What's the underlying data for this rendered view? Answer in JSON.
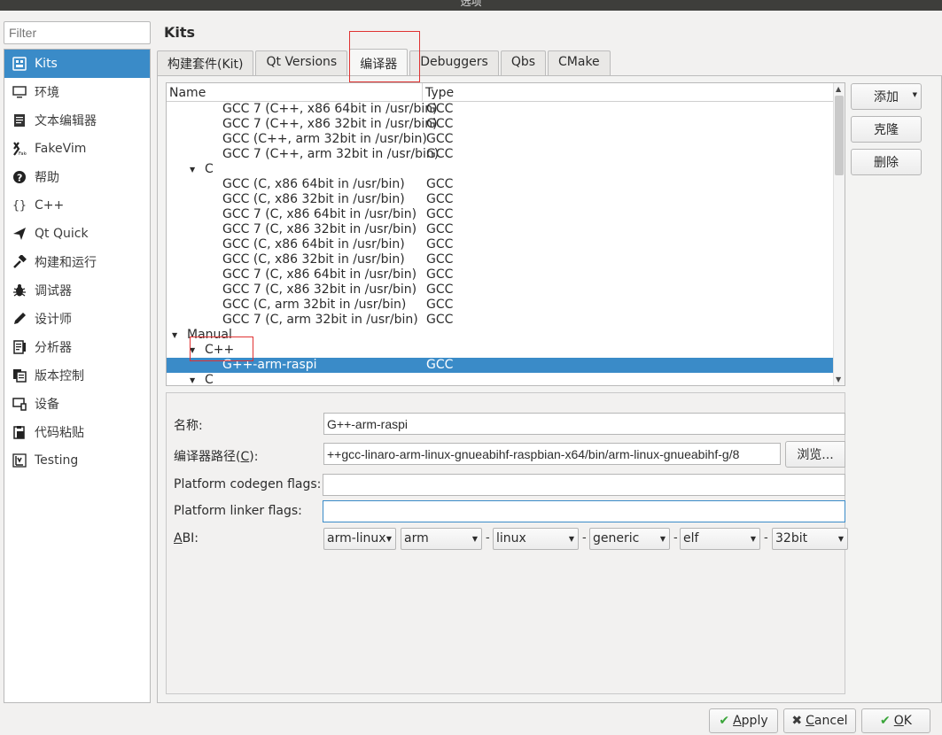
{
  "window": {
    "title": "选项"
  },
  "filter": {
    "placeholder": "Filter"
  },
  "sidebar": {
    "items": [
      {
        "label": "Kits",
        "icon": "kits-icon",
        "active": true
      },
      {
        "label": "环境",
        "icon": "monitor-icon"
      },
      {
        "label": "文本编辑器",
        "icon": "text-editor-icon"
      },
      {
        "label": "FakeVim",
        "icon": "fakevim-icon"
      },
      {
        "label": "帮助",
        "icon": "help-icon"
      },
      {
        "label": "C++",
        "icon": "braces-icon"
      },
      {
        "label": "Qt Quick",
        "icon": "qt-quick-icon"
      },
      {
        "label": "构建和运行",
        "icon": "hammer-icon"
      },
      {
        "label": "调试器",
        "icon": "bug-icon"
      },
      {
        "label": "设计师",
        "icon": "pencil-icon"
      },
      {
        "label": "分析器",
        "icon": "analyzer-icon"
      },
      {
        "label": "版本控制",
        "icon": "version-control-icon"
      },
      {
        "label": "设备",
        "icon": "device-icon"
      },
      {
        "label": "代码粘贴",
        "icon": "clipboard-icon"
      },
      {
        "label": "Testing",
        "icon": "testing-icon"
      }
    ]
  },
  "page": {
    "title": "Kits"
  },
  "tabs": [
    {
      "label": "构建套件(Kit)"
    },
    {
      "label": "Qt Versions"
    },
    {
      "label": "编译器",
      "active": true
    },
    {
      "label": "Debuggers"
    },
    {
      "label": "Qbs"
    },
    {
      "label": "CMake"
    }
  ],
  "tree": {
    "columns": {
      "name": "Name",
      "type": "Type"
    },
    "rows": [
      {
        "name": "GCC 7 (C++, x86 64bit in /usr/bin)",
        "type": "GCC"
      },
      {
        "name": "GCC 7 (C++, x86 32bit in /usr/bin)",
        "type": "GCC"
      },
      {
        "name": "GCC (C++, arm 32bit in /usr/bin)",
        "type": "GCC"
      },
      {
        "name": "GCC 7 (C++, arm 32bit in /usr/bin)",
        "type": "GCC"
      },
      {
        "name": "C",
        "type": ""
      },
      {
        "name": "GCC (C, x86 64bit in /usr/bin)",
        "type": "GCC"
      },
      {
        "name": "GCC (C, x86 32bit in /usr/bin)",
        "type": "GCC"
      },
      {
        "name": "GCC 7 (C, x86 64bit in /usr/bin)",
        "type": "GCC"
      },
      {
        "name": "GCC 7 (C, x86 32bit in /usr/bin)",
        "type": "GCC"
      },
      {
        "name": "GCC (C, x86 64bit in /usr/bin)",
        "type": "GCC"
      },
      {
        "name": "GCC (C, x86 32bit in /usr/bin)",
        "type": "GCC"
      },
      {
        "name": "GCC 7 (C, x86 64bit in /usr/bin)",
        "type": "GCC"
      },
      {
        "name": "GCC 7 (C, x86 32bit in /usr/bin)",
        "type": "GCC"
      },
      {
        "name": "GCC (C, arm 32bit in /usr/bin)",
        "type": "GCC"
      },
      {
        "name": "GCC 7 (C, arm 32bit in /usr/bin)",
        "type": "GCC"
      },
      {
        "name": "Manual",
        "type": ""
      },
      {
        "name": "C++",
        "type": ""
      },
      {
        "name": "G++-arm-raspi",
        "type": "GCC",
        "selected": true
      },
      {
        "name": "C",
        "type": ""
      }
    ]
  },
  "buttons": {
    "add": "添加",
    "clone": "克隆",
    "remove": "删除"
  },
  "form": {
    "name_label": "名称:",
    "name_value": "G++-arm-raspi",
    "path_label_prefix": "编译器路径(",
    "path_label_mnemonic": "C",
    "path_label_suffix": "):",
    "path_value": "8/gcc-linaro-arm-linux-gnueabihf-raspbian-x64/bin/arm-linux-gnueabihf-g++",
    "browse": "浏览...",
    "codegen_label": "Platform codegen flags:",
    "codegen_value": "",
    "linker_label": "Platform linker flags:",
    "linker_value": "",
    "abi_label_mnemonic": "A",
    "abi_label_rest": "BI:",
    "abi": {
      "preset": "arm-linux",
      "arch": "arm",
      "os": "linux",
      "flavor": "generic",
      "format": "elf",
      "width": "32bit",
      "separator": "-"
    }
  },
  "dialog": {
    "apply_mnemonic": "A",
    "apply_rest": "pply",
    "cancel_mnemonic": "C",
    "cancel_rest": "ancel",
    "ok_mnemonic": "O",
    "ok_rest": "K"
  }
}
